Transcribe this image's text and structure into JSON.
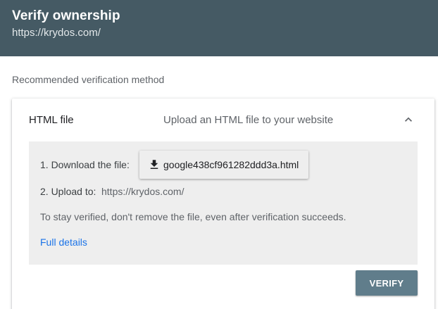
{
  "header": {
    "title": "Verify ownership",
    "url": "https://krydos.com/"
  },
  "section": {
    "label": "Recommended verification method"
  },
  "method": {
    "name": "HTML file",
    "description": "Upload an HTML file to your website",
    "expand_icon": "chevron-up-icon",
    "steps": {
      "download_label": "1. Download the file:",
      "download_filename": "google438cf961282ddd3a.html",
      "download_icon": "download-icon",
      "upload_label": "2. Upload to:",
      "upload_url": "https://krydos.com/"
    },
    "note": "To stay verified, don't remove the file, even after verification succeeds.",
    "details_link": "Full details"
  },
  "actions": {
    "verify_label": "VERIFY"
  },
  "colors": {
    "header_bg": "#455a64",
    "link": "#1a73e8",
    "verify_bg": "#607d8b",
    "panel_bg": "#eeeeee"
  }
}
